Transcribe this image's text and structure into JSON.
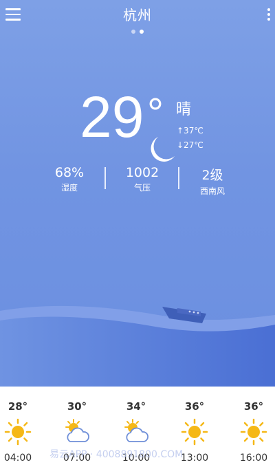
{
  "header": {
    "city": "杭州",
    "page_count": 2,
    "active_page": 2,
    "icons": {
      "menu": "menu-icon",
      "more": "more-vertical-icon"
    }
  },
  "current": {
    "temperature": "29",
    "degree_symbol": "°",
    "condition": "晴",
    "condition_icon": "moon-icon",
    "high": "↑37℃",
    "low": "↓27℃"
  },
  "stats": [
    {
      "value": "68%",
      "label": "湿度"
    },
    {
      "value": "1002",
      "label": "气压"
    },
    {
      "value": "2级",
      "label": "西南风"
    }
  ],
  "hourly": [
    {
      "temp": "28°",
      "icon": "sun-icon",
      "time": "04:00"
    },
    {
      "temp": "30°",
      "icon": "partly-cloudy-icon",
      "time": "07:00"
    },
    {
      "temp": "34°",
      "icon": "partly-cloudy-icon",
      "time": "10:00"
    },
    {
      "temp": "36°",
      "icon": "sun-icon",
      "time": "13:00"
    },
    {
      "temp": "36°",
      "icon": "sun-icon",
      "time": "16:00"
    }
  ],
  "watermark": "易云APP · 4008891800.COM",
  "colors": {
    "sky": "#7194e2",
    "wave_light": "#8aa8ec",
    "wave_dark": "#4f73d6",
    "sun": "#f5b817",
    "cloud": "#6f8fd8"
  }
}
